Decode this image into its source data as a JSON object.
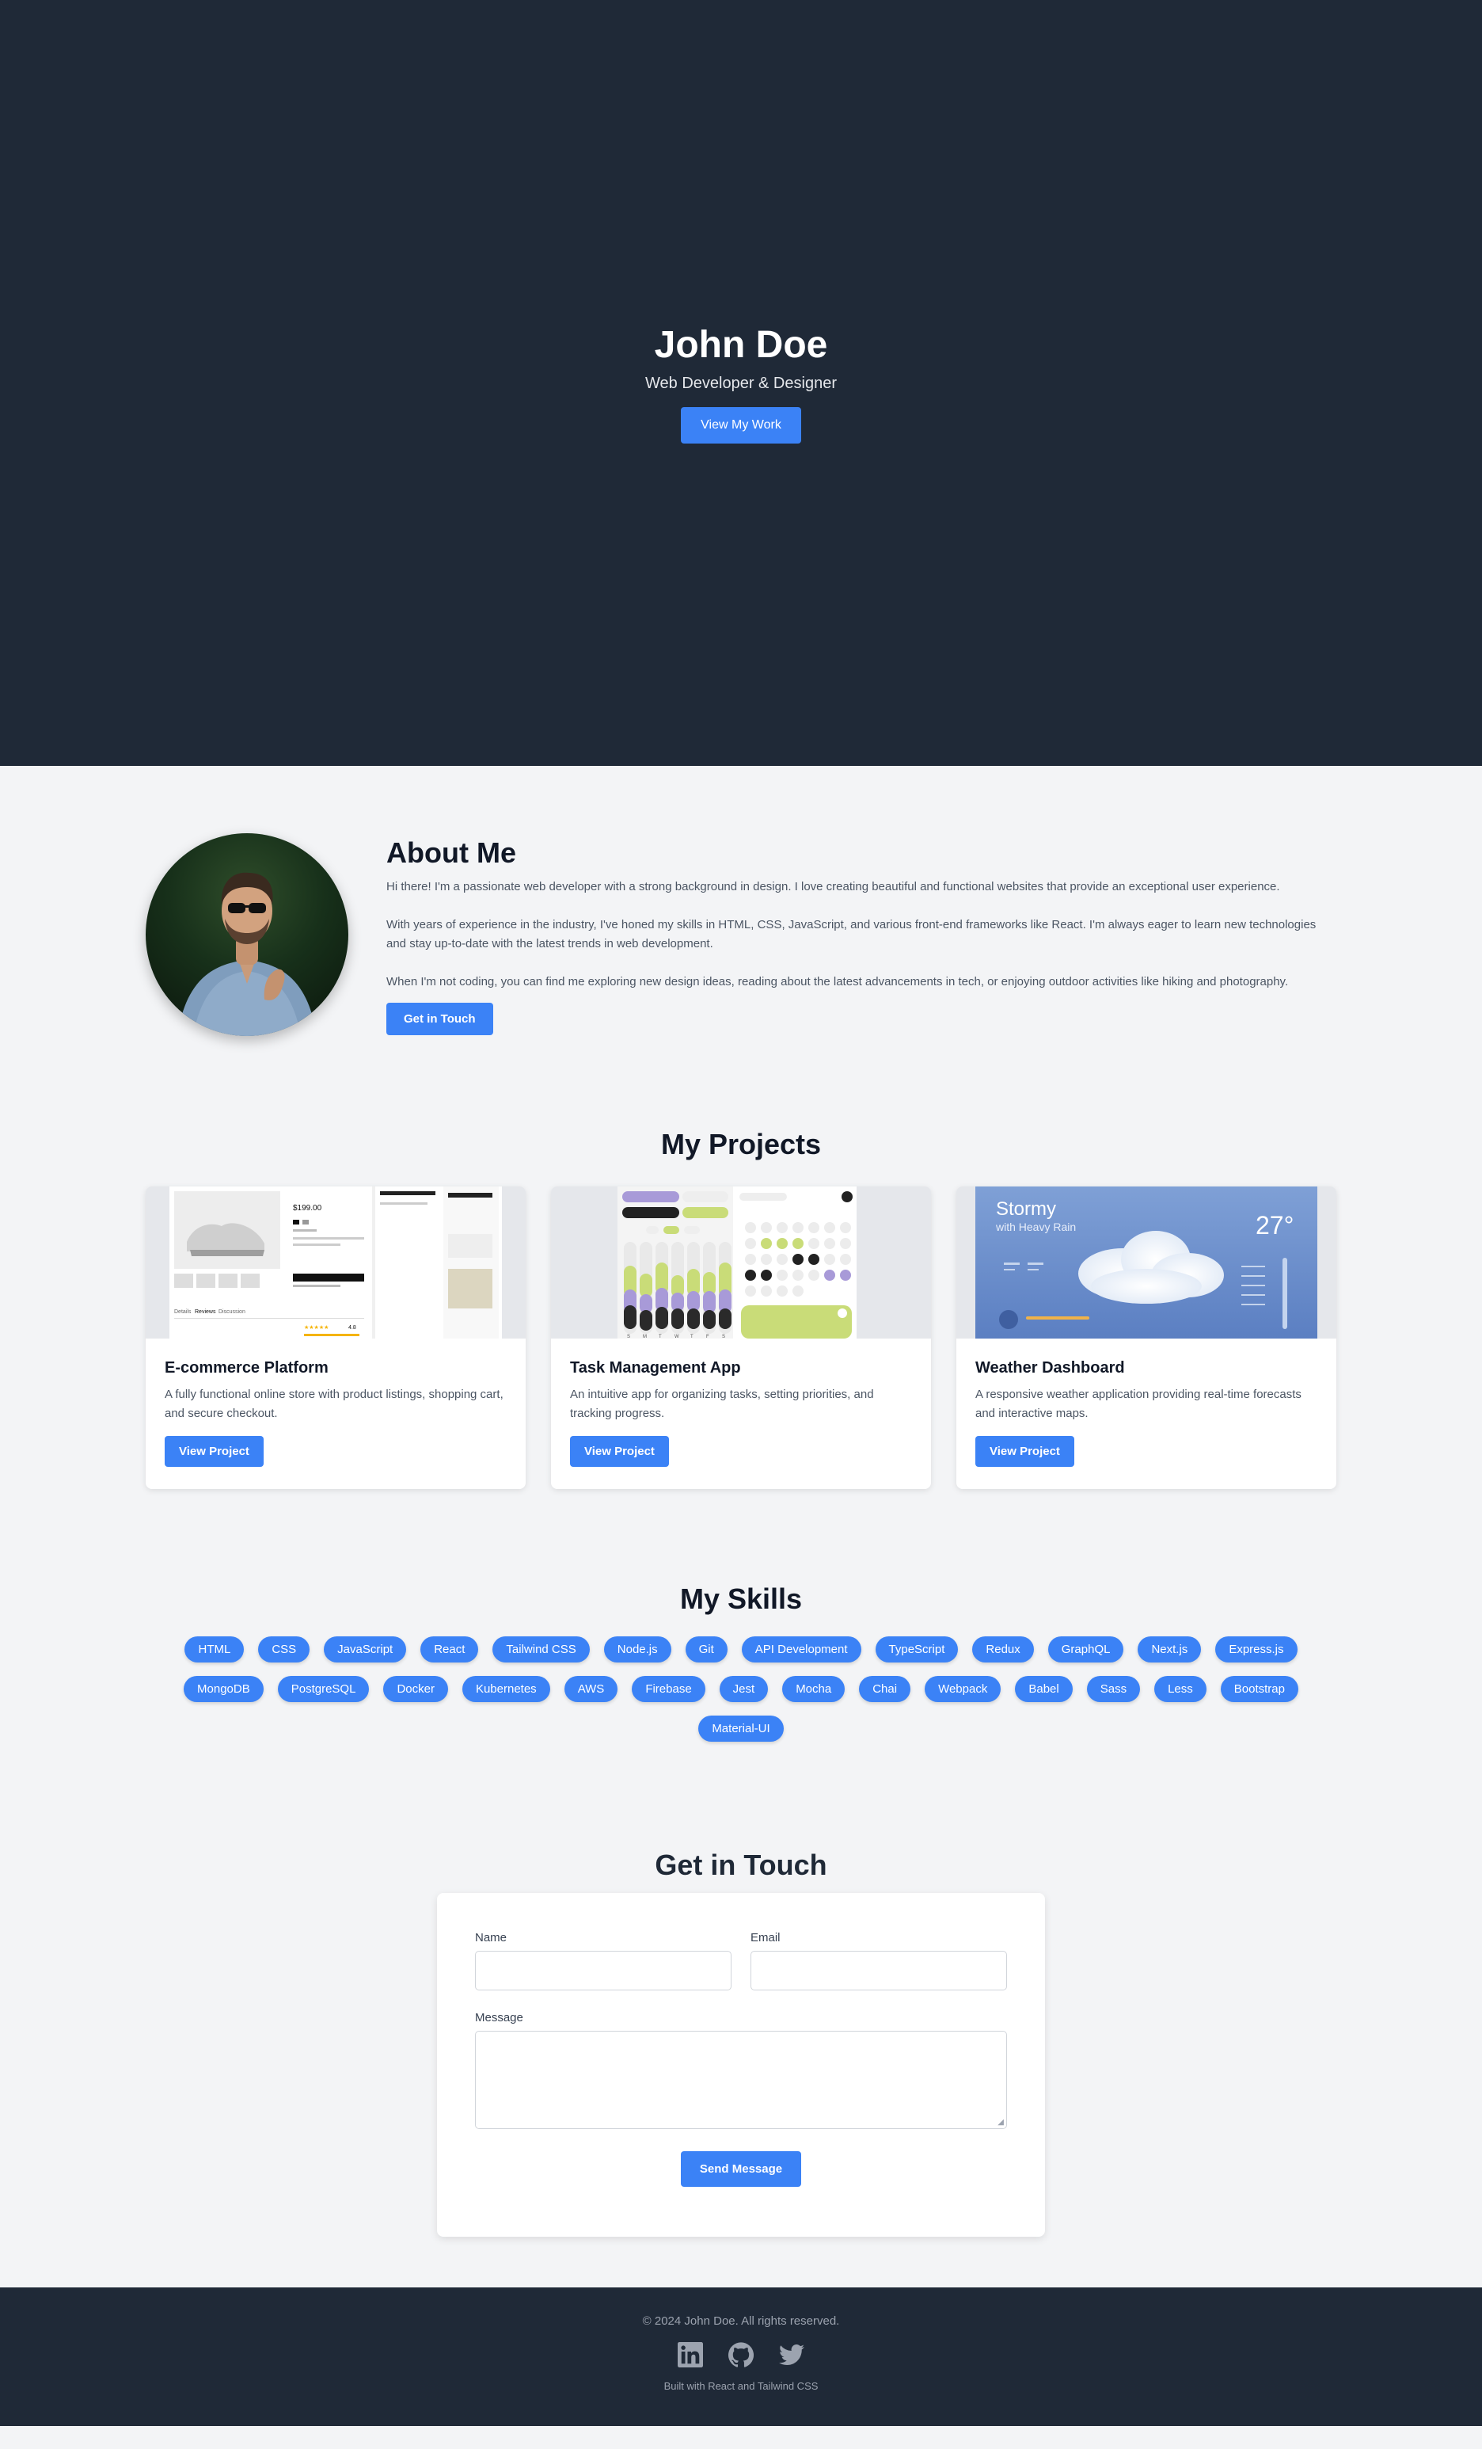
{
  "hero": {
    "name": "John Doe",
    "tagline": "Web Developer & Designer",
    "cta": "View My Work"
  },
  "about": {
    "title": "About Me",
    "paragraphs": [
      "Hi there! I'm a passionate web developer with a strong background in design. I love creating beautiful and functional websites that provide an exceptional user experience.",
      "With years of experience in the industry, I've honed my skills in HTML, CSS, JavaScript, and various front-end frameworks like React. I'm always eager to learn new technologies and stay up-to-date with the latest trends in web development.",
      "When I'm not coding, you can find me exploring new design ideas, reading about the latest advancements in tech, or enjoying outdoor activities like hiking and photography."
    ],
    "cta": "Get in Touch"
  },
  "projects": {
    "title": "My Projects",
    "items": [
      {
        "title": "E-commerce Platform",
        "description": "A fully functional online store with product listings, shopping cart, and secure checkout.",
        "button": "View Project",
        "image_texts": [
          "$199.00",
          "Details",
          "Reviews",
          "Discussion",
          "4.8"
        ]
      },
      {
        "title": "Task Management App",
        "description": "An intuitive app for organizing tasks, setting priorities, and tracking progress.",
        "button": "View Project",
        "image_texts": [
          "S",
          "M",
          "T",
          "W",
          "T",
          "F",
          "S"
        ]
      },
      {
        "title": "Weather Dashboard",
        "description": "A responsive weather application providing real-time forecasts and interactive maps.",
        "button": "View Project",
        "image_texts": [
          "Stormy",
          "with Heavy Rain",
          "27°"
        ]
      }
    ]
  },
  "skills": {
    "title": "My Skills",
    "items": [
      "HTML",
      "CSS",
      "JavaScript",
      "React",
      "Tailwind CSS",
      "Node.js",
      "Git",
      "API Development",
      "TypeScript",
      "Redux",
      "GraphQL",
      "Next.js",
      "Express.js",
      "MongoDB",
      "PostgreSQL",
      "Docker",
      "Kubernetes",
      "AWS",
      "Firebase",
      "Jest",
      "Mocha",
      "Chai",
      "Webpack",
      "Babel",
      "Sass",
      "Less",
      "Bootstrap",
      "Material-UI"
    ]
  },
  "contact": {
    "title": "Get in Touch",
    "name_label": "Name",
    "email_label": "Email",
    "message_label": "Message",
    "name_value": "",
    "email_value": "",
    "message_value": "",
    "submit": "Send Message"
  },
  "footer": {
    "copyright": "© 2024 John Doe. All rights reserved.",
    "built_with": "Built with React and Tailwind CSS",
    "socials": [
      "linkedin-icon",
      "github-icon",
      "twitter-icon"
    ]
  },
  "colors": {
    "dark": "#1f2937",
    "accent": "#3b82f6",
    "background": "#f3f4f6"
  }
}
